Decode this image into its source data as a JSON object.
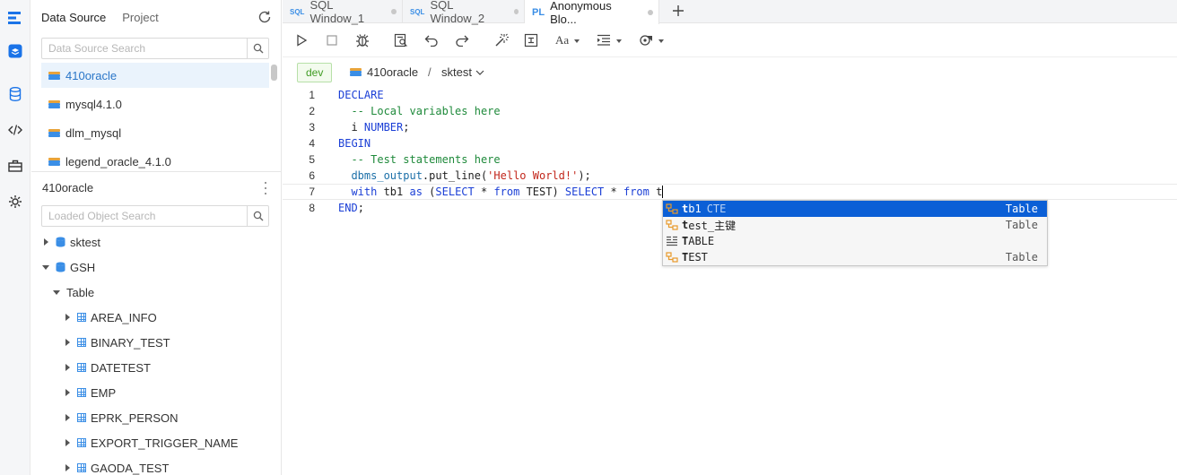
{
  "rail": {
    "icons": [
      "logo-icon",
      "layers-icon",
      "database-icon",
      "code-icon",
      "toolbox-icon",
      "settings-shield-icon"
    ]
  },
  "sidebar": {
    "tabs": [
      {
        "label": "Data Source",
        "active": true
      },
      {
        "label": "Project",
        "active": false
      }
    ],
    "datasource_search_placeholder": "Data Source Search",
    "datasources": [
      {
        "label": "410oracle",
        "selected": true
      },
      {
        "label": "mysql4.1.0",
        "selected": false
      },
      {
        "label": "dlm_mysql",
        "selected": false
      },
      {
        "label": "legend_oracle_4.1.0",
        "selected": false
      }
    ],
    "connection_title": "410oracle",
    "object_search_placeholder": "Loaded Object Search",
    "tree": [
      {
        "label": "sktest",
        "level": 0,
        "type": "schema",
        "expanded": false
      },
      {
        "label": "GSH",
        "level": 0,
        "type": "schema",
        "expanded": true
      },
      {
        "label": "Table",
        "level": 1,
        "type": "folder",
        "expanded": true
      },
      {
        "label": "AREA_INFO",
        "level": 2,
        "type": "table",
        "expanded": false
      },
      {
        "label": "BINARY_TEST",
        "level": 2,
        "type": "table",
        "expanded": false
      },
      {
        "label": "DATETEST",
        "level": 2,
        "type": "table",
        "expanded": false
      },
      {
        "label": "EMP",
        "level": 2,
        "type": "table",
        "expanded": false
      },
      {
        "label": "EPRK_PERSON",
        "level": 2,
        "type": "table",
        "expanded": false
      },
      {
        "label": "EXPORT_TRIGGER_NAME",
        "level": 2,
        "type": "table",
        "expanded": false
      },
      {
        "label": "GAODA_TEST",
        "level": 2,
        "type": "table",
        "expanded": false
      }
    ]
  },
  "tabs": [
    {
      "badge": "SQL",
      "label": "SQL Window_1",
      "active": false
    },
    {
      "badge": "SQL",
      "label": "SQL Window_2",
      "active": false
    },
    {
      "badge": "PL",
      "label": "Anonymous Blo...",
      "active": true
    }
  ],
  "toolbar": {
    "font_label": "Aa"
  },
  "context": {
    "env": "dev",
    "connection": "410oracle",
    "separator": "/",
    "database": "sktest"
  },
  "editor": {
    "current_line": 7,
    "lines": [
      {
        "n": "1",
        "tokens": [
          {
            "t": "DECLARE",
            "c": "kw"
          }
        ]
      },
      {
        "n": "2",
        "tokens": [
          {
            "t": "  -- Local variables here",
            "c": "cm"
          }
        ]
      },
      {
        "n": "3",
        "tokens": [
          {
            "t": "  i ",
            "c": ""
          },
          {
            "t": "NUMBER",
            "c": "kw"
          },
          {
            "t": ";",
            "c": ""
          }
        ]
      },
      {
        "n": "4",
        "tokens": [
          {
            "t": "BEGIN",
            "c": "kw"
          }
        ]
      },
      {
        "n": "5",
        "tokens": [
          {
            "t": "  -- Test statements here",
            "c": "cm"
          }
        ]
      },
      {
        "n": "6",
        "tokens": [
          {
            "t": "  dbms_output",
            "c": "fn"
          },
          {
            "t": ".put_line(",
            "c": ""
          },
          {
            "t": "'Hello World!'",
            "c": "str"
          },
          {
            "t": ");",
            "c": ""
          }
        ]
      },
      {
        "n": "7",
        "tokens": [
          {
            "t": "  ",
            "c": ""
          },
          {
            "t": "with",
            "c": "kw"
          },
          {
            "t": " tb1 ",
            "c": ""
          },
          {
            "t": "as",
            "c": "kw"
          },
          {
            "t": " (",
            "c": ""
          },
          {
            "t": "SELECT",
            "c": "kw"
          },
          {
            "t": " * ",
            "c": ""
          },
          {
            "t": "from",
            "c": "kw"
          },
          {
            "t": " TEST) ",
            "c": ""
          },
          {
            "t": "SELECT",
            "c": "kw"
          },
          {
            "t": " * ",
            "c": ""
          },
          {
            "t": "from",
            "c": "kw"
          },
          {
            "t": " t",
            "c": ""
          }
        ]
      },
      {
        "n": "8",
        "tokens": [
          {
            "t": "END",
            "c": "kw"
          },
          {
            "t": ";",
            "c": ""
          }
        ]
      }
    ]
  },
  "autocomplete": {
    "items": [
      {
        "match": "t",
        "rest": "b1",
        "sub": "CTE",
        "kind": "Table",
        "icon": "cte-icon",
        "selected": true
      },
      {
        "match": "t",
        "rest": "est_主键",
        "sub": "",
        "kind": "Table",
        "icon": "cte-icon",
        "selected": false
      },
      {
        "match": "T",
        "rest": "ABLE",
        "sub": "",
        "kind": "",
        "icon": "keyword-icon",
        "selected": false
      },
      {
        "match": "T",
        "rest": "EST",
        "sub": "",
        "kind": "Table",
        "icon": "cte-icon",
        "selected": false
      }
    ]
  },
  "colors": {
    "accent": "#2a76c8",
    "selection": "#0b5fd6",
    "keyword": "#1b3fd6",
    "comment": "#1f8a3b",
    "string": "#c2261b",
    "env_tag": "#3f9c22"
  }
}
